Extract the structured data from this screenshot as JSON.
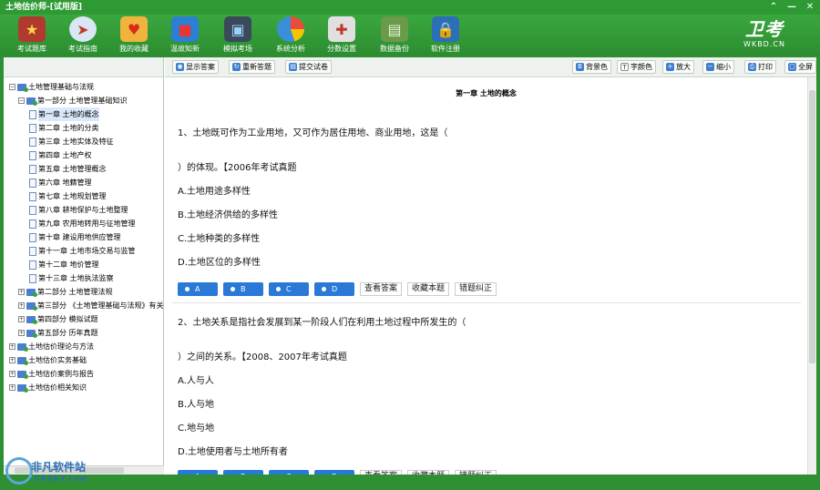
{
  "window": {
    "title": "土地估价师-[试用版]",
    "controls": [
      "⌃",
      "—",
      "✕"
    ]
  },
  "toolbar": {
    "items": [
      {
        "label": "考试题库",
        "icon": "book-icon",
        "color": "#c0392b"
      },
      {
        "label": "考试指南",
        "icon": "compass-icon",
        "color": "#3b7fd4"
      },
      {
        "label": "我的收藏",
        "icon": "heart-icon",
        "color": "#e67e22"
      },
      {
        "label": "温故知新",
        "icon": "cubes-icon",
        "color": "#2c7fd2"
      },
      {
        "label": "模拟考场",
        "icon": "monitor-icon",
        "color": "#555555"
      },
      {
        "label": "系统分析",
        "icon": "pie-chart-icon",
        "color": "#3a8fd8"
      },
      {
        "label": "分数设置",
        "icon": "tools-icon",
        "color": "#bdbdbd"
      },
      {
        "label": "数据备份",
        "icon": "disk-icon",
        "color": "#6a9a4a"
      },
      {
        "label": "软件注册",
        "icon": "lock-icon",
        "color": "#d9a520"
      }
    ],
    "logo": {
      "text": "卫考",
      "sub": "WKBD.CN"
    }
  },
  "tree": {
    "nodes": [
      {
        "label": "土地管理基础与法规",
        "type": "folder",
        "exp": "−",
        "level": 0
      },
      {
        "label": "第一部分  土地管理基础知识",
        "type": "folder",
        "exp": "−",
        "level": 1
      },
      {
        "label": "第一章  土地的概念",
        "type": "doc",
        "level": 2,
        "selected": true
      },
      {
        "label": "第二章  土地的分类",
        "type": "doc",
        "level": 2
      },
      {
        "label": "第三章  土地实体及特征",
        "type": "doc",
        "level": 2
      },
      {
        "label": "第四章  土地产权",
        "type": "doc",
        "level": 2
      },
      {
        "label": "第五章  土地管理概念",
        "type": "doc",
        "level": 2
      },
      {
        "label": "第六章  地籍管理",
        "type": "doc",
        "level": 2
      },
      {
        "label": "第七章  土地规划管理",
        "type": "doc",
        "level": 2
      },
      {
        "label": "第八章  耕地保护与土地整理",
        "type": "doc",
        "level": 2
      },
      {
        "label": "第九章  农用地转用与征地管理",
        "type": "doc",
        "level": 2
      },
      {
        "label": "第十章  建设用地供应管理",
        "type": "doc",
        "level": 2
      },
      {
        "label": "第十一章  土地市场交易与监管",
        "type": "doc",
        "level": 2
      },
      {
        "label": "第十二章  地价管理",
        "type": "doc",
        "level": 2
      },
      {
        "label": "第十三章  土地执法监察",
        "type": "doc",
        "level": 2
      },
      {
        "label": "第二部分  土地管理法规",
        "type": "folder",
        "exp": "+",
        "level": 1
      },
      {
        "label": "第三部分  《土地管理基础与法规》有关计算",
        "type": "folder",
        "exp": "+",
        "level": 1
      },
      {
        "label": "第四部分  模拟试题",
        "type": "folder",
        "exp": "+",
        "level": 1
      },
      {
        "label": "第五部分  历年真题",
        "type": "folder",
        "exp": "+",
        "level": 1
      },
      {
        "label": "土地估价理论与方法",
        "type": "folder",
        "exp": "+",
        "level": 0
      },
      {
        "label": "土地估价实务基础",
        "type": "folder",
        "exp": "+",
        "level": 0
      },
      {
        "label": "土地估价案例与报告",
        "type": "folder",
        "exp": "+",
        "level": 0
      },
      {
        "label": "土地估价相关知识",
        "type": "folder",
        "exp": "+",
        "level": 0
      }
    ]
  },
  "actions_left": [
    {
      "label": "显示答案",
      "icon": "eye-icon"
    },
    {
      "label": "重新答题",
      "icon": "refresh-icon"
    },
    {
      "label": "提交试卷",
      "icon": "submit-icon"
    }
  ],
  "actions_right": [
    {
      "label": "背景色",
      "icon": "background-color-icon"
    },
    {
      "label": "字颜色",
      "icon": "font-color-icon"
    },
    {
      "label": "放大",
      "icon": "zoom-in-icon"
    },
    {
      "label": "缩小",
      "icon": "zoom-out-icon"
    },
    {
      "label": "打印",
      "icon": "print-icon"
    },
    {
      "label": "全屏",
      "icon": "fullscreen-icon"
    }
  ],
  "content": {
    "chapter": "第一章  土地的概念",
    "questions": [
      {
        "line1": "1、土地既可作为工业用地，又可作为居住用地、商业用地，这是（",
        "line2": "）的体现。【2006年考试真题",
        "options": [
          "A.土地用途多样性",
          "B.土地经济供给的多样性",
          "C.土地种类的多样性",
          "D.土地区位的多样性"
        ]
      },
      {
        "line1": "2、土地关系是指社会发展到某一阶段人们在利用土地过程中所发生的（",
        "line2": "）之间的关系。【2008、2007年考试真题",
        "options": [
          "A.人与人",
          "B.人与地",
          "C.地与地",
          "D.土地使用者与土地所有者"
        ]
      }
    ],
    "answer_buttons": [
      "A",
      "B",
      "C",
      "D"
    ],
    "tool_buttons": [
      "查看答案",
      "收藏本题",
      "错题纠正"
    ]
  },
  "watermark": {
    "text": "非凡软件站",
    "sub": "CRSKY.com"
  }
}
